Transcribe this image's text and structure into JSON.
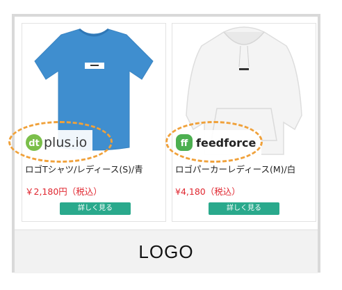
{
  "products": [
    {
      "title": "ロゴTシャツ/レディース(S)/青",
      "price": "￥2,180円（税込）",
      "button_label": "詳しく見る",
      "brand_logo_text": "plus.io",
      "brand_logo_mark": "dt",
      "product_color": "#3f8ecf"
    },
    {
      "title": "ロゴパーカーレディース(M)/白",
      "price": "¥4,180（税込）",
      "button_label": "詳しく見る",
      "brand_logo_text": "feedforce",
      "brand_logo_mark": "ff",
      "product_color": "#f4f4f4"
    }
  ],
  "footer": {
    "logo_text": "LOGO"
  },
  "colors": {
    "accent_button": "#2aa98c",
    "price_red": "#e0262f",
    "highlight_orange": "#f0a13a",
    "frame_gray": "#d9d9d9"
  }
}
